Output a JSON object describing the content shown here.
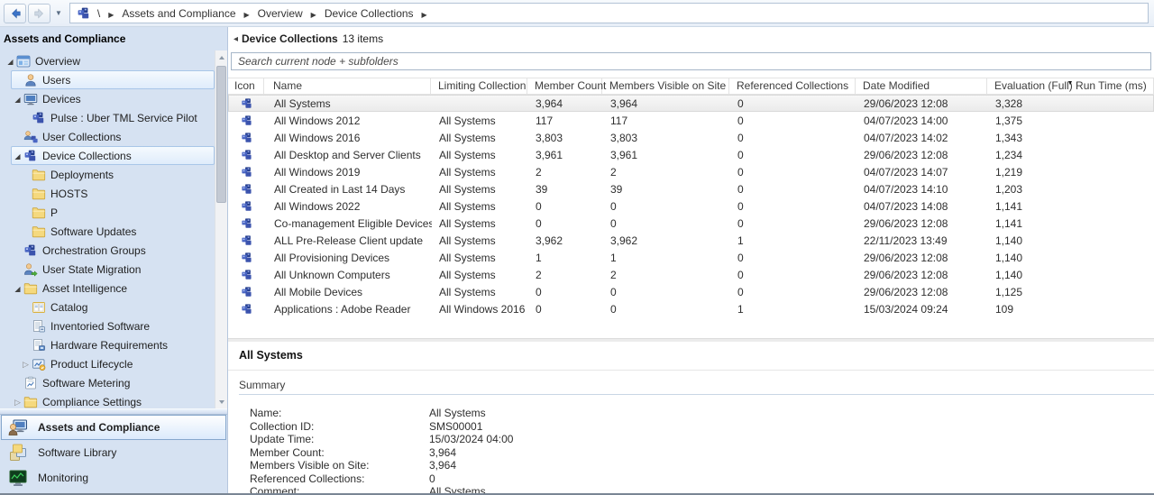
{
  "colors": {
    "accent_blue": "#3c74c8",
    "sidebar_bg": "#d6e2f2",
    "selection_border": "#a9c6e8"
  },
  "topbar": {
    "back_icon": "back-arrow-icon",
    "forward_icon": "forward-arrow-icon",
    "breadcrumb": {
      "icon": "collection-icon",
      "root": "\\",
      "items": [
        "Assets and Compliance",
        "Overview",
        "Device Collections"
      ]
    }
  },
  "sidebar": {
    "header": "Assets and Compliance",
    "tree": [
      {
        "level": 0,
        "expander": "expanded",
        "icon": "overview-icon",
        "label": "Overview",
        "selected": false
      },
      {
        "level": 1,
        "expander": "none",
        "icon": "users-icon",
        "label": "Users",
        "selected": true
      },
      {
        "level": 1,
        "expander": "expanded",
        "icon": "devices-icon",
        "label": "Devices",
        "selected": false
      },
      {
        "level": 2,
        "expander": "none",
        "icon": "collection-icon",
        "label": "Pulse : Uber TML Service Pilot",
        "selected": false
      },
      {
        "level": 1,
        "expander": "none",
        "icon": "user-collection-icon",
        "label": "User Collections",
        "selected": false
      },
      {
        "level": 1,
        "expander": "expanded",
        "icon": "collection-icon",
        "label": "Device Collections",
        "selected": true
      },
      {
        "level": 2,
        "expander": "none",
        "icon": "folder-icon",
        "label": "Deployments",
        "selected": false
      },
      {
        "level": 2,
        "expander": "none",
        "icon": "folder-icon",
        "label": "HOSTS",
        "selected": false
      },
      {
        "level": 2,
        "expander": "none",
        "icon": "folder-icon",
        "label": "P",
        "selected": false
      },
      {
        "level": 2,
        "expander": "none",
        "icon": "folder-icon",
        "label": "Software Updates",
        "selected": false
      },
      {
        "level": 1,
        "expander": "none",
        "icon": "collection-icon",
        "label": "Orchestration Groups",
        "selected": false
      },
      {
        "level": 1,
        "expander": "none",
        "icon": "user-state-icon",
        "label": "User State Migration",
        "selected": false
      },
      {
        "level": 1,
        "expander": "expanded",
        "icon": "folder-icon",
        "label": "Asset Intelligence",
        "selected": false
      },
      {
        "level": 2,
        "expander": "none",
        "icon": "catalog-icon",
        "label": "Catalog",
        "selected": false
      },
      {
        "level": 2,
        "expander": "none",
        "icon": "inventoried-software-icon",
        "label": "Inventoried Software",
        "selected": false
      },
      {
        "level": 2,
        "expander": "none",
        "icon": "hardware-requirements-icon",
        "label": "Hardware Requirements",
        "selected": false
      },
      {
        "level": 2,
        "expander": "collapsed",
        "icon": "product-lifecycle-icon",
        "label": "Product Lifecycle",
        "selected": false
      },
      {
        "level": 1,
        "expander": "none",
        "icon": "software-metering-icon",
        "label": "Software Metering",
        "selected": false
      },
      {
        "level": 1,
        "expander": "collapsed",
        "icon": "folder-icon",
        "label": "Compliance Settings",
        "selected": false
      }
    ],
    "nav": [
      {
        "icon": "assets-icon",
        "label": "Assets and Compliance",
        "selected": true
      },
      {
        "icon": "library-icon",
        "label": "Software Library",
        "selected": false
      },
      {
        "icon": "monitoring-icon",
        "label": "Monitoring",
        "selected": false
      }
    ]
  },
  "main": {
    "title": "Device Collections",
    "items_count": "13 items",
    "search_placeholder": "Search current node + subfolders",
    "row_icon": "collection-icon",
    "columns": [
      "Icon",
      "Name",
      "Limiting Collection",
      "Member Count",
      "Members Visible on Site",
      "Referenced Collections",
      "Date Modified",
      "Evaluation (Full) Run Time (ms)"
    ],
    "sorted_column": "Evaluation (Full) Run Time (ms)",
    "sort_direction": "desc",
    "rows": [
      {
        "name": "All Systems",
        "limiting_collection": "",
        "member_count": "3,964",
        "members_visible_on_site": "3,964",
        "referenced_collections": "0",
        "date_modified": "29/06/2023 12:08",
        "evaluation_run_time_ms": "3,328",
        "selected": true
      },
      {
        "name": "All Windows 2012",
        "limiting_collection": "All Systems",
        "member_count": "117",
        "members_visible_on_site": "117",
        "referenced_collections": "0",
        "date_modified": "04/07/2023 14:00",
        "evaluation_run_time_ms": "1,375",
        "selected": false
      },
      {
        "name": "All Windows 2016",
        "limiting_collection": "All Systems",
        "member_count": "3,803",
        "members_visible_on_site": "3,803",
        "referenced_collections": "0",
        "date_modified": "04/07/2023 14:02",
        "evaluation_run_time_ms": "1,343",
        "selected": false
      },
      {
        "name": "All Desktop and Server Clients",
        "limiting_collection": "All Systems",
        "member_count": "3,961",
        "members_visible_on_site": "3,961",
        "referenced_collections": "0",
        "date_modified": "29/06/2023 12:08",
        "evaluation_run_time_ms": "1,234",
        "selected": false
      },
      {
        "name": "All Windows 2019",
        "limiting_collection": "All Systems",
        "member_count": "2",
        "members_visible_on_site": "2",
        "referenced_collections": "0",
        "date_modified": "04/07/2023 14:07",
        "evaluation_run_time_ms": "1,219",
        "selected": false
      },
      {
        "name": "All Created in Last 14 Days",
        "limiting_collection": "All Systems",
        "member_count": "39",
        "members_visible_on_site": "39",
        "referenced_collections": "0",
        "date_modified": "04/07/2023 14:10",
        "evaluation_run_time_ms": "1,203",
        "selected": false
      },
      {
        "name": "All Windows 2022",
        "limiting_collection": "All Systems",
        "member_count": "0",
        "members_visible_on_site": "0",
        "referenced_collections": "0",
        "date_modified": "04/07/2023 14:08",
        "evaluation_run_time_ms": "1,141",
        "selected": false
      },
      {
        "name": "Co-management Eligible Devices",
        "limiting_collection": "All Systems",
        "member_count": "0",
        "members_visible_on_site": "0",
        "referenced_collections": "0",
        "date_modified": "29/06/2023 12:08",
        "evaluation_run_time_ms": "1,141",
        "selected": false
      },
      {
        "name": "ALL Pre-Release Client update",
        "limiting_collection": "All Systems",
        "member_count": "3,962",
        "members_visible_on_site": "3,962",
        "referenced_collections": "1",
        "date_modified": "22/11/2023 13:49",
        "evaluation_run_time_ms": "1,140",
        "selected": false
      },
      {
        "name": "All Provisioning Devices",
        "limiting_collection": "All Systems",
        "member_count": "1",
        "members_visible_on_site": "1",
        "referenced_collections": "0",
        "date_modified": "29/06/2023 12:08",
        "evaluation_run_time_ms": "1,140",
        "selected": false
      },
      {
        "name": "All Unknown Computers",
        "limiting_collection": "All Systems",
        "member_count": "2",
        "members_visible_on_site": "2",
        "referenced_collections": "0",
        "date_modified": "29/06/2023 12:08",
        "evaluation_run_time_ms": "1,140",
        "selected": false
      },
      {
        "name": "All Mobile Devices",
        "limiting_collection": "All Systems",
        "member_count": "0",
        "members_visible_on_site": "0",
        "referenced_collections": "0",
        "date_modified": "29/06/2023 12:08",
        "evaluation_run_time_ms": "1,125",
        "selected": false
      },
      {
        "name": "Applications : Adobe Reader",
        "limiting_collection": "All Windows 2016",
        "member_count": "0",
        "members_visible_on_site": "0",
        "referenced_collections": "1",
        "date_modified": "15/03/2024 09:24",
        "evaluation_run_time_ms": "109",
        "selected": false
      }
    ]
  },
  "details": {
    "title": "All Systems",
    "section_label": "Summary",
    "fields": [
      {
        "label": "Name:",
        "value": "All Systems"
      },
      {
        "label": "Collection ID:",
        "value": "SMS00001"
      },
      {
        "label": "Update Time:",
        "value": "15/03/2024 04:00"
      },
      {
        "label": "Member Count:",
        "value": "3,964"
      },
      {
        "label": "Members Visible on Site:",
        "value": "3,964"
      },
      {
        "label": "Referenced Collections:",
        "value": "0"
      },
      {
        "label": "Comment:",
        "value": "All Systems"
      }
    ]
  }
}
